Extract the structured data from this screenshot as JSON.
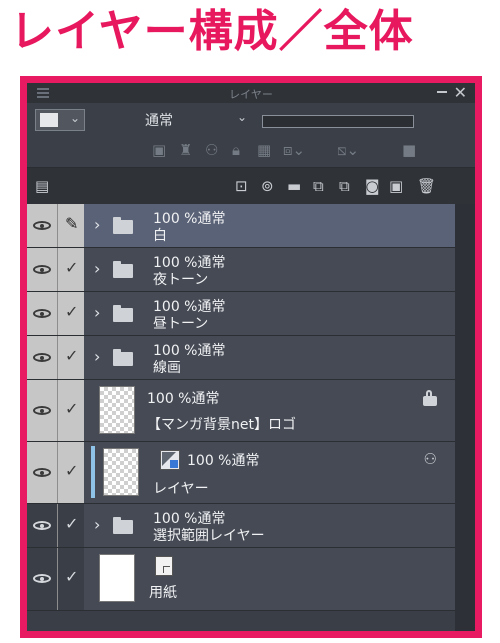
{
  "heading": "レイヤー構成／全体",
  "panel": {
    "title": "レイヤー",
    "blend_mode": "通常",
    "window_min_icon": "minimize-icon",
    "window_close_icon": "close-icon"
  },
  "layers": [
    {
      "mode": "100 %通常",
      "name": "白",
      "type": "folder",
      "selected": true,
      "edit": "pen"
    },
    {
      "mode": "100 %通常",
      "name": "夜トーン",
      "type": "folder"
    },
    {
      "mode": "100 %通常",
      "name": "昼トーン",
      "type": "folder"
    },
    {
      "mode": "100 %通常",
      "name": "線画",
      "type": "folder"
    },
    {
      "mode": "100 %通常",
      "name": "【マンガ背景net】ロゴ",
      "type": "raster",
      "locked": true
    },
    {
      "mode": "100 %通常",
      "name": "レイヤー",
      "type": "raster",
      "mask": true,
      "reference": true
    },
    {
      "mode": "100 %通常",
      "name": "選択範囲レイヤー",
      "type": "folder",
      "hidden_visibility": true
    },
    {
      "mode": "",
      "name": "用紙",
      "type": "paper",
      "hidden_visibility": true
    }
  ],
  "colors": {
    "accent": "#e8185e",
    "panel_bg": "#3b4048",
    "selected_row": "#5a6277"
  }
}
